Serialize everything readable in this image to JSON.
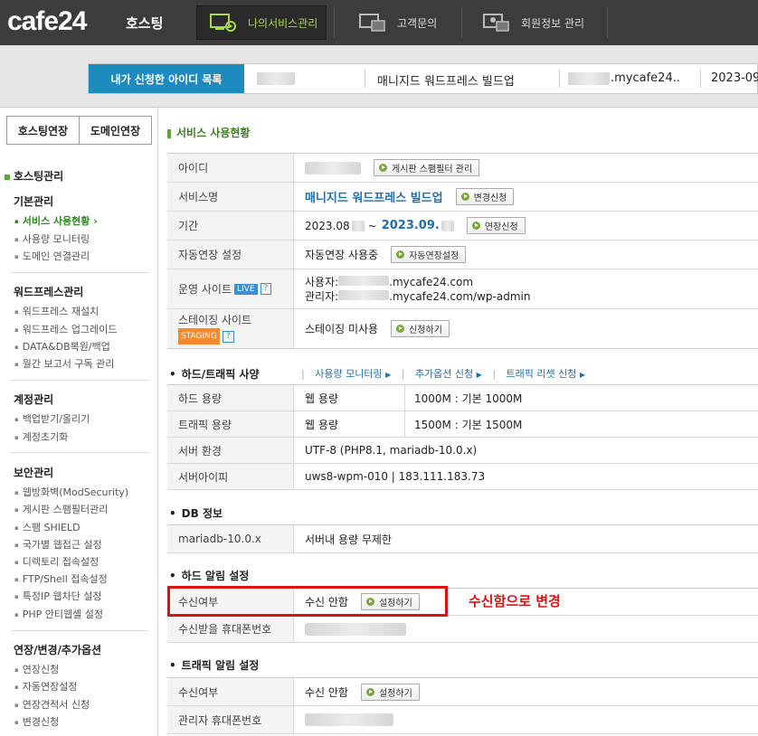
{
  "header": {
    "logo": "cafe24",
    "logo_sub": "호스팅",
    "nav": [
      {
        "label": "나의서비스관리",
        "icon": "service-gear-icon"
      },
      {
        "label": "고객문의",
        "icon": "customer-chat-icon"
      },
      {
        "label": "회원정보 관리",
        "icon": "member-info-icon"
      }
    ]
  },
  "idbar": {
    "label": "내가 신청한 아이디 목록",
    "service": "매니지드 워드프레스 빌드업",
    "domain": ".mycafe24..",
    "date": "2023-09"
  },
  "sidebar": {
    "tabs": [
      "호스팅연장",
      "도메인연장"
    ],
    "title": "호스팅관리",
    "groups": [
      {
        "name": "기본관리",
        "items": [
          "서비스 사용현황 ›",
          "사용량 모니터링",
          "도메인 연결관리"
        ]
      },
      {
        "name": "워드프레스관리",
        "items": [
          "워드프레스 재설치",
          "워드프레스 업그레이드",
          "DATA&DB복원/백업",
          "월간 보고서 구독 관리"
        ]
      },
      {
        "name": "계정관리",
        "items": [
          "백업받기/올리기",
          "계정초기화"
        ]
      },
      {
        "name": "보안관리",
        "items": [
          "웹방화벽(ModSecurity)",
          "게시판 스팸필터관리",
          "스팸 SHIELD",
          "국가별 웹접근 설정",
          "디렉토리 접속설정",
          "FTP/Shell 접속설정",
          "특정IP 웹차단 설정",
          "PHP 안티웹셸 설정"
        ]
      },
      {
        "name": "연장/변경/추가옵션",
        "items": [
          "연장신청",
          "자동연장설정",
          "연장견적서 신청",
          "변경신청"
        ]
      }
    ]
  },
  "usage": {
    "title": "서비스 사용현황",
    "rows": [
      {
        "label": "아이디",
        "button": "게시판 스팸필터 관리"
      },
      {
        "label": "서비스명",
        "value": "매니지드 워드프레스 빌드업",
        "button": "변경신청"
      },
      {
        "label": "기간",
        "value_start": "2023.08",
        "tilde": "~",
        "value_end": "2023.09.",
        "button": "연장신청"
      },
      {
        "label": "자동연장 설정",
        "value": "자동연장 사용중",
        "button": "자동연장설정"
      },
      {
        "label": "운영 사이트",
        "badge": "LIVE",
        "help": "?",
        "user_prefix": "사용자:",
        "user_url": ".mycafe24.com",
        "admin_prefix": "관리자:",
        "admin_url": ".mycafe24.com/wp-admin"
      },
      {
        "label": "스테이징 사이트",
        "badge": "STAGING",
        "help": "?",
        "value": "스테이징 미사용",
        "button": "신청하기"
      }
    ]
  },
  "hw": {
    "title": "하드/트래픽 사양",
    "links": [
      "사용량 모니터링",
      "추가옵션 신청",
      "트래픽 리셋 신청"
    ],
    "rows": [
      {
        "label": "하드 용량",
        "type": "웹 용량",
        "value": "1000M : 기본 1000M"
      },
      {
        "label": "트래픽 용량",
        "type": "웹 용량",
        "value": "1500M : 기본 1500M"
      },
      {
        "label": "서버 환경",
        "value": "UTF-8 (PHP8.1, mariadb-10.0.x)"
      },
      {
        "label": "서버아이피",
        "value": "uws8-wpm-010 | 183.111.183.73"
      }
    ]
  },
  "db": {
    "title": "DB 정보",
    "name": "mariadb-10.0.x",
    "value": "서버내 용량 무제한"
  },
  "hdd_alert": {
    "title": "하드 알림 설정",
    "rows": [
      {
        "label": "수신여부",
        "value": "수신 안함",
        "button": "설정하기"
      },
      {
        "label": "수신받을 휴대폰번호"
      }
    ],
    "note": "수신함으로 변경"
  },
  "traffic_alert": {
    "title": "트래픽 알림 설정",
    "rows": [
      {
        "label": "수신여부",
        "value": "수신 안함",
        "button": "설정하기"
      },
      {
        "label": "관리자 휴대폰번호"
      }
    ]
  },
  "colors": {
    "brand_green": "#5ca63a",
    "link_blue": "#1e6fae",
    "accent_red": "#e01010",
    "topbar": "#3c3c3c"
  }
}
